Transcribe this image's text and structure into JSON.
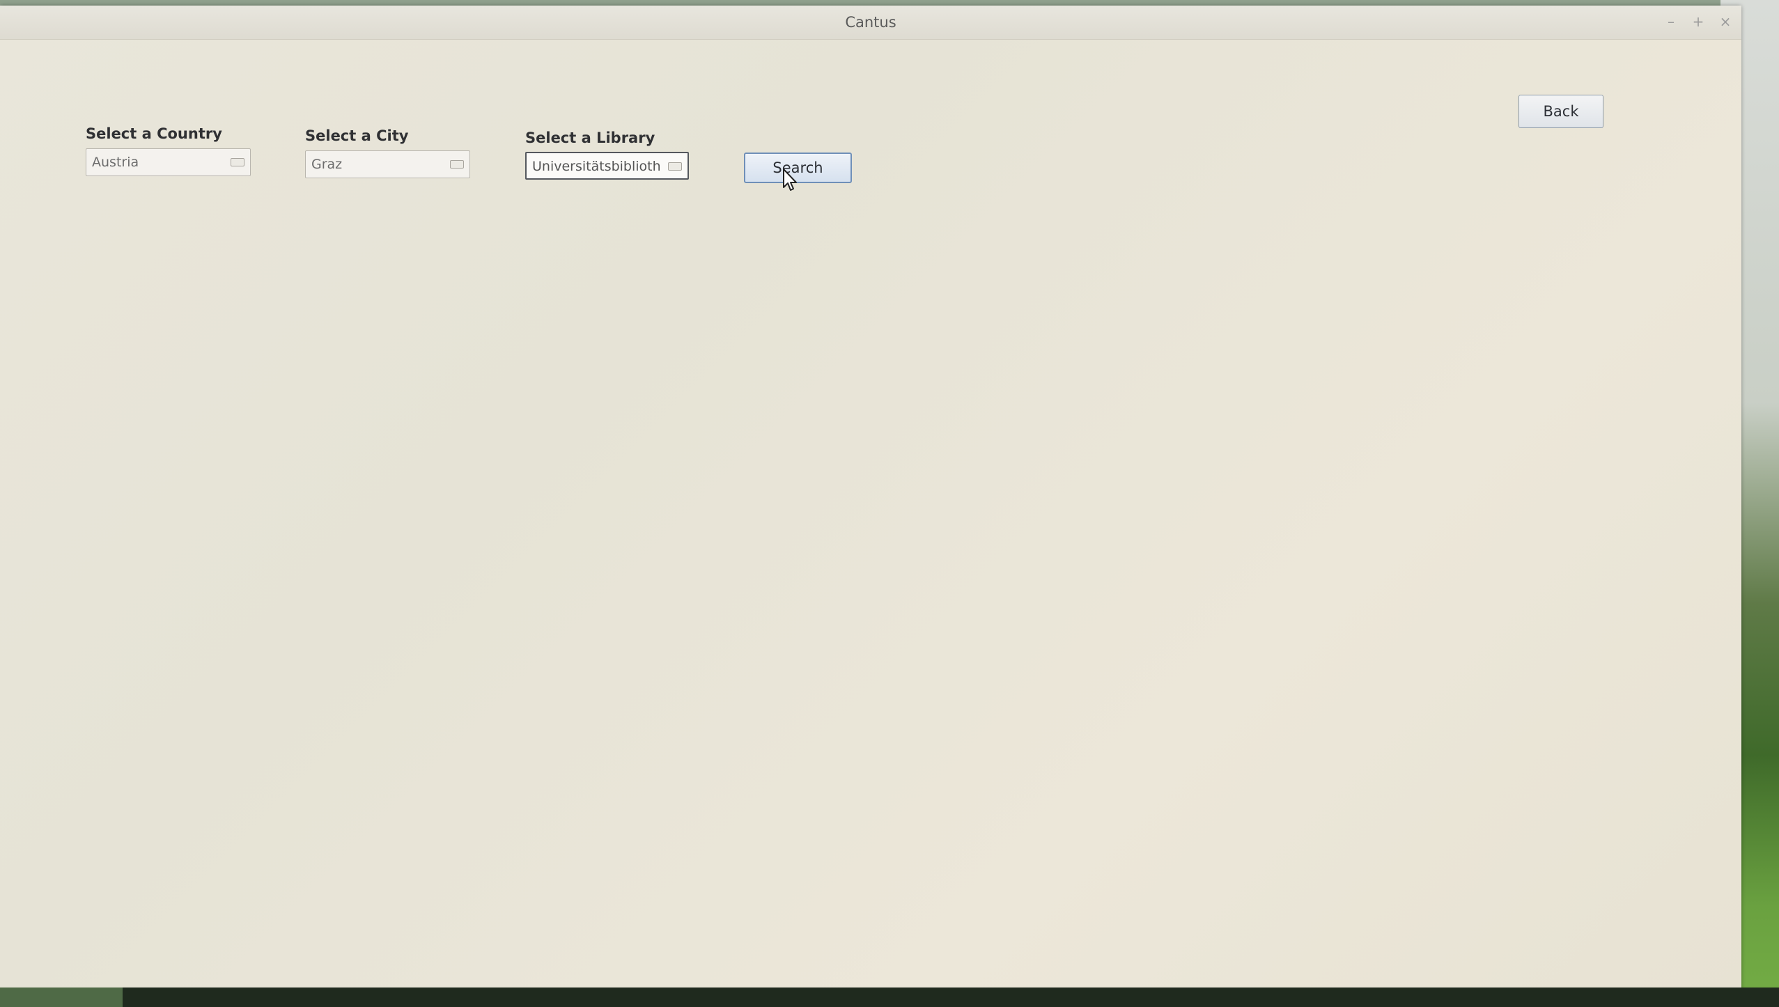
{
  "window": {
    "title": "Cantus",
    "controls": {
      "minimize": "–",
      "maximize": "+",
      "close": "×"
    }
  },
  "form": {
    "country": {
      "label": "Select a Country",
      "value": "Austria"
    },
    "city": {
      "label": "Select a City",
      "value": "Graz"
    },
    "library": {
      "label": "Select a Library",
      "value": "Universitätsbibliothe"
    },
    "search_label": "Search"
  },
  "back_label": "Back"
}
